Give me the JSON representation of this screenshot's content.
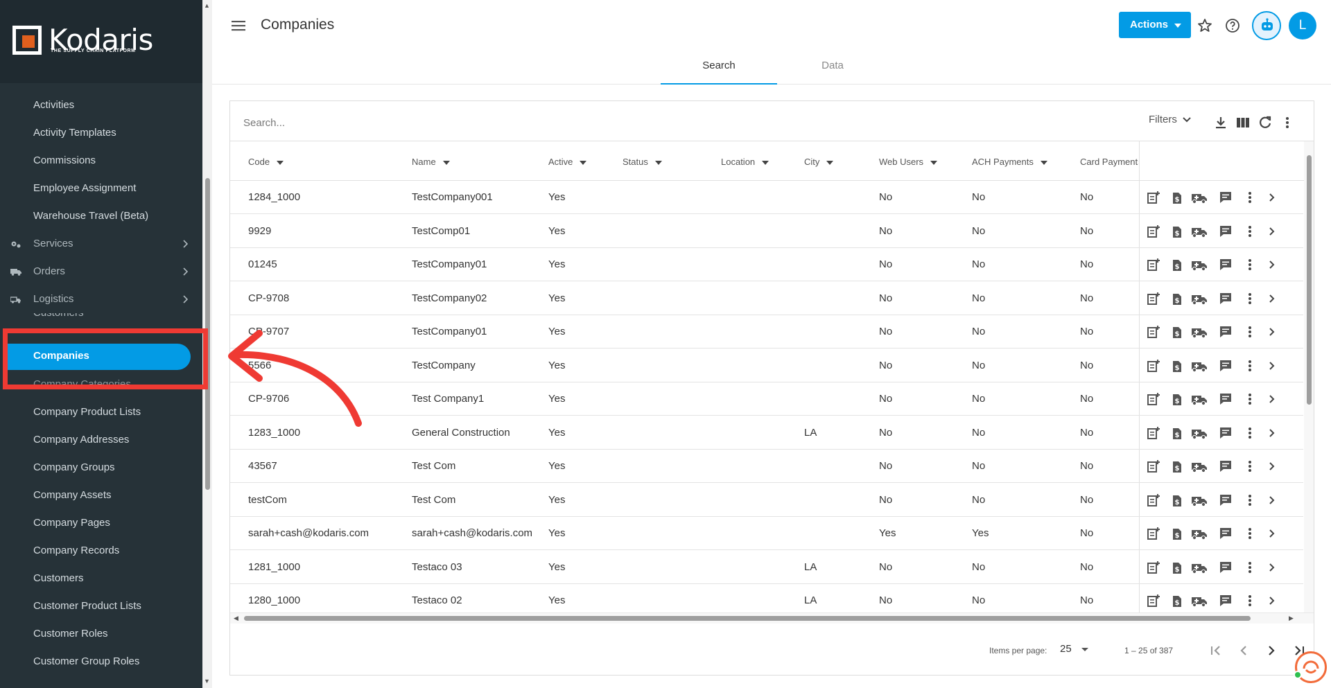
{
  "app": {
    "logo_text": "Kodaris",
    "logo_tagline": "THE SUPPLY CHAIN PLATFORM"
  },
  "sidebar": {
    "items": [
      {
        "label": "Activities"
      },
      {
        "label": "Activity Templates"
      },
      {
        "label": "Commissions"
      },
      {
        "label": "Employee Assignment"
      },
      {
        "label": "Warehouse Travel (Beta)"
      },
      {
        "label": "Services"
      },
      {
        "label": "Orders"
      },
      {
        "label": "Logistics"
      },
      {
        "label": "Customers"
      },
      {
        "label": "Companies"
      },
      {
        "label": "Company Categories"
      },
      {
        "label": "Company Product Lists"
      },
      {
        "label": "Company Addresses"
      },
      {
        "label": "Company Groups"
      },
      {
        "label": "Company Assets"
      },
      {
        "label": "Company Pages"
      },
      {
        "label": "Company Records"
      },
      {
        "label": "Customers"
      },
      {
        "label": "Customer Product Lists"
      },
      {
        "label": "Customer Roles"
      },
      {
        "label": "Customer Group Roles"
      }
    ]
  },
  "header": {
    "title": "Companies",
    "actions_label": "Actions",
    "avatar_initial": "L"
  },
  "tabs": [
    {
      "label": "Search"
    },
    {
      "label": "Data"
    }
  ],
  "toolbar": {
    "search_placeholder": "Search...",
    "filters_label": "Filters"
  },
  "table": {
    "columns": [
      "Code",
      "Name",
      "Active",
      "Status",
      "Location",
      "City",
      "Web Users",
      "ACH Payments",
      "Card Payments"
    ],
    "rows": [
      [
        "1284_1000",
        "TestCompany001",
        "Yes",
        "",
        "",
        "",
        "No",
        "No",
        "No"
      ],
      [
        "9929",
        "TestComp01",
        "Yes",
        "",
        "",
        "",
        "No",
        "No",
        "No"
      ],
      [
        "01245",
        "TestCompany01",
        "Yes",
        "",
        "",
        "",
        "No",
        "No",
        "No"
      ],
      [
        "CP-9708",
        "TestCompany02",
        "Yes",
        "",
        "",
        "",
        "No",
        "No",
        "No"
      ],
      [
        "CP-9707",
        "TestCompany01",
        "Yes",
        "",
        "",
        "",
        "No",
        "No",
        "No"
      ],
      [
        "5566",
        "TestCompany",
        "Yes",
        "",
        "",
        "",
        "No",
        "No",
        "No"
      ],
      [
        "CP-9706",
        "Test Company1",
        "Yes",
        "",
        "",
        "",
        "No",
        "No",
        "No"
      ],
      [
        "1283_1000",
        "General Construction",
        "Yes",
        "",
        "",
        "LA",
        "No",
        "No",
        "No"
      ],
      [
        "43567",
        "Test Com",
        "Yes",
        "",
        "",
        "",
        "No",
        "No",
        "No"
      ],
      [
        "testCom",
        "Test Com",
        "Yes",
        "",
        "",
        "",
        "No",
        "No",
        "No"
      ],
      [
        "sarah+cash@kodaris.com",
        "sarah+cash@kodaris.com",
        "Yes",
        "",
        "",
        "",
        "Yes",
        "Yes",
        "No"
      ],
      [
        "1281_1000",
        "Testaco 03",
        "Yes",
        "",
        "",
        "LA",
        "No",
        "No",
        "No"
      ],
      [
        "1280_1000",
        "Testaco 02",
        "Yes",
        "",
        "",
        "LA",
        "No",
        "No",
        "No"
      ]
    ]
  },
  "paginator": {
    "items_per_page_label": "Items per page:",
    "items_per_page": "25",
    "range_label": "1 – 25 of 387"
  },
  "colors": {
    "sidebar_bg": "#263238",
    "accent": "#039be5",
    "highlight": "#ef3a33",
    "logo_orange": "#e0601e"
  }
}
